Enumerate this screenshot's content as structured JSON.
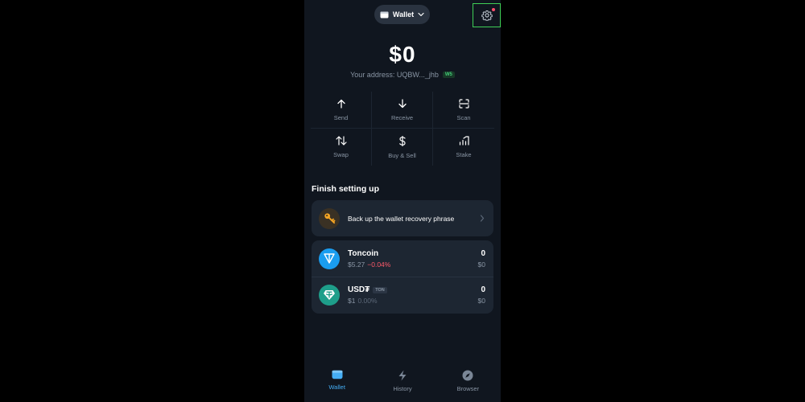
{
  "header": {
    "wallet_label": "Wallet"
  },
  "balance": {
    "amount": "$0",
    "address": "Your address: UQBW..._jhb",
    "badge": "W5"
  },
  "actions": [
    {
      "label": "Send",
      "icon": "arrow-up-icon"
    },
    {
      "label": "Receive",
      "icon": "arrow-down-icon"
    },
    {
      "label": "Scan",
      "icon": "scan-icon"
    },
    {
      "label": "Swap",
      "icon": "swap-icon"
    },
    {
      "label": "Buy & Sell",
      "icon": "dollar-icon"
    },
    {
      "label": "Stake",
      "icon": "stake-icon"
    }
  ],
  "setup": {
    "title": "Finish setting up",
    "item": "Back up the wallet recovery phrase"
  },
  "tokens": [
    {
      "name": "Toncoin",
      "tag": "",
      "price": "$5.27",
      "change": "−0.04%",
      "amount": "0",
      "fiat": "$0"
    },
    {
      "name": "USD₮",
      "tag": "TON",
      "price": "$1",
      "change": "0.00%",
      "amount": "0",
      "fiat": "$0"
    }
  ],
  "nav": [
    {
      "label": "Wallet",
      "active": true
    },
    {
      "label": "History",
      "active": false
    },
    {
      "label": "Browser",
      "active": false
    }
  ],
  "colors": {
    "background": "#10161f",
    "card": "#1d2632",
    "accent": "#45aef5",
    "negative": "#ff5a6a",
    "highlight": "#3fcf56"
  }
}
